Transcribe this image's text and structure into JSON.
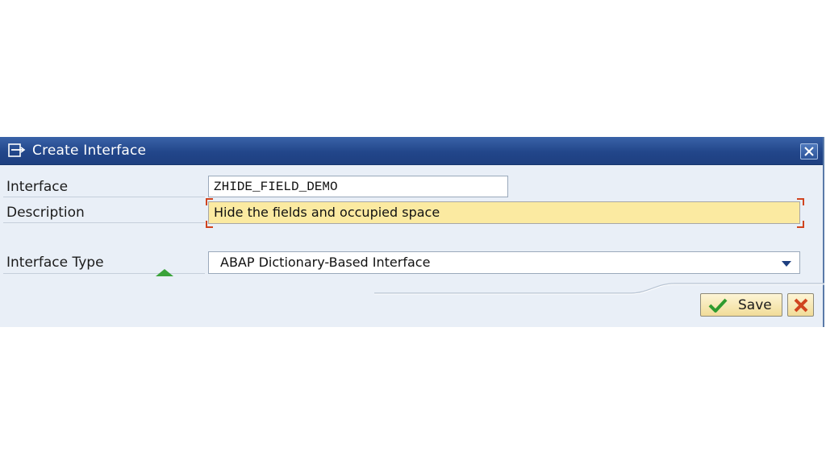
{
  "dialog": {
    "title": "Create Interface",
    "icons": {
      "title": "window-create-icon",
      "close": "close-icon"
    }
  },
  "form": {
    "interface": {
      "label": "Interface",
      "value": "ZHIDE_FIELD_DEMO"
    },
    "description": {
      "label": "Description",
      "value": "Hide the fields and occupied space",
      "required": true
    },
    "interface_type": {
      "label": "Interface Type",
      "value": "ABAP Dictionary-Based Interface"
    }
  },
  "footer": {
    "save_label": "Save",
    "cancel_icon": "cancel-icon",
    "save_icon": "checkmark-icon"
  },
  "colors": {
    "title_bar": "#22468a",
    "dialog_bg": "#e9eff7",
    "required_field": "#fbeaa1",
    "button_bg": "#f1dc98",
    "save_check": "#2f9b2f",
    "cancel_x": "#d0441f"
  }
}
